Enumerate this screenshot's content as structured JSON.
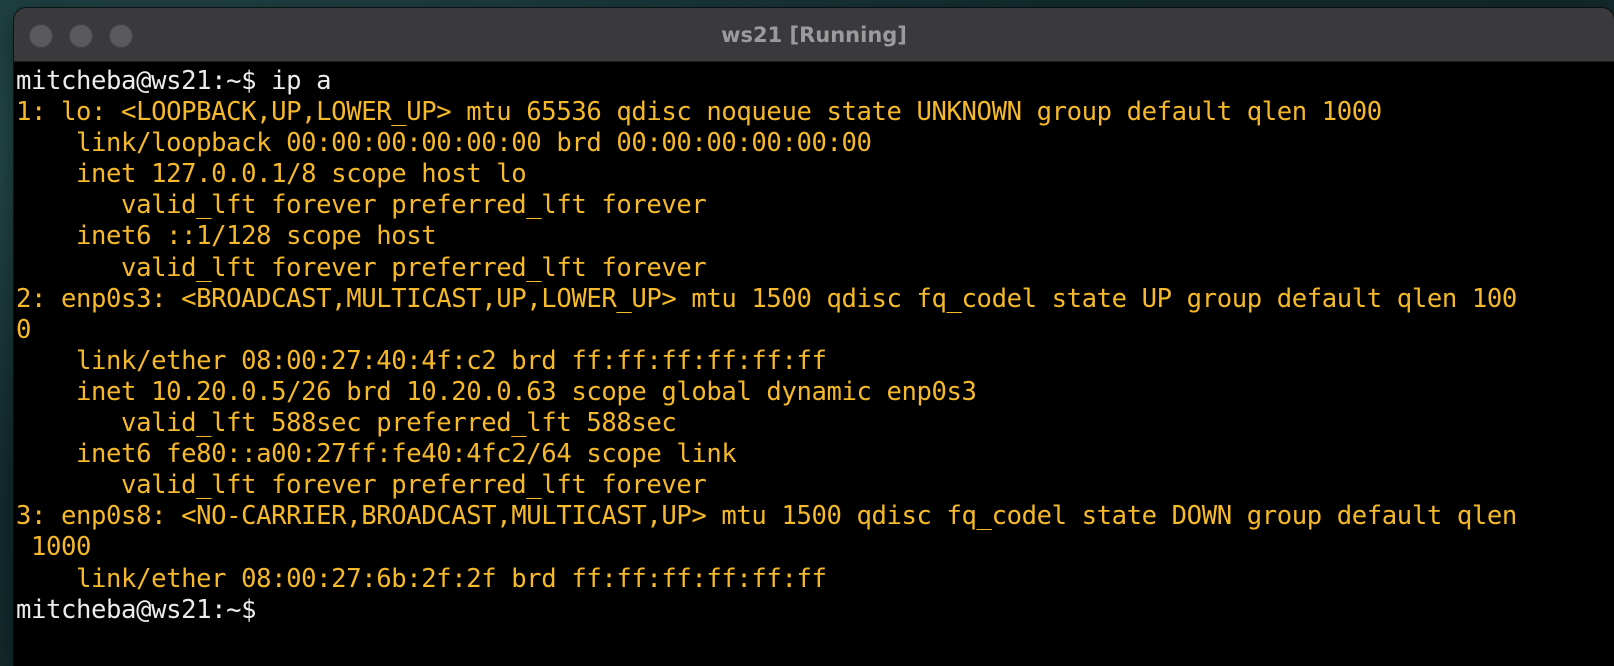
{
  "window": {
    "title": "ws21 [Running]",
    "traffic_lights": [
      "close",
      "minimize",
      "zoom"
    ]
  },
  "colors": {
    "terminal_bg": "#000000",
    "output_text": "#f5b92a",
    "prompt_text": "#ececec",
    "titlebar_bg": "#3a3a3c"
  },
  "terminal": {
    "lines": [
      {
        "text": "mitcheba@ws21:~$ ip a",
        "kind": "prompt"
      },
      {
        "text": "1: lo: <LOOPBACK,UP,LOWER_UP> mtu 65536 qdisc noqueue state UNKNOWN group default qlen 1000",
        "kind": "output"
      },
      {
        "text": "    link/loopback 00:00:00:00:00:00 brd 00:00:00:00:00:00",
        "kind": "output"
      },
      {
        "text": "    inet 127.0.0.1/8 scope host lo",
        "kind": "output"
      },
      {
        "text": "       valid_lft forever preferred_lft forever",
        "kind": "output"
      },
      {
        "text": "    inet6 ::1/128 scope host",
        "kind": "output"
      },
      {
        "text": "       valid_lft forever preferred_lft forever",
        "kind": "output"
      },
      {
        "text": "2: enp0s3: <BROADCAST,MULTICAST,UP,LOWER_UP> mtu 1500 qdisc fq_codel state UP group default qlen 100",
        "kind": "output"
      },
      {
        "text": "0",
        "kind": "output"
      },
      {
        "text": "    link/ether 08:00:27:40:4f:c2 brd ff:ff:ff:ff:ff:ff",
        "kind": "output"
      },
      {
        "text": "    inet 10.20.0.5/26 brd 10.20.0.63 scope global dynamic enp0s3",
        "kind": "output"
      },
      {
        "text": "       valid_lft 588sec preferred_lft 588sec",
        "kind": "output"
      },
      {
        "text": "    inet6 fe80::a00:27ff:fe40:4fc2/64 scope link",
        "kind": "output"
      },
      {
        "text": "       valid_lft forever preferred_lft forever",
        "kind": "output"
      },
      {
        "text": "3: enp0s8: <NO-CARRIER,BROADCAST,MULTICAST,UP> mtu 1500 qdisc fq_codel state DOWN group default qlen",
        "kind": "output"
      },
      {
        "text": " 1000",
        "kind": "output"
      },
      {
        "text": "    link/ether 08:00:27:6b:2f:2f brd ff:ff:ff:ff:ff:ff",
        "kind": "output"
      },
      {
        "text": "mitcheba@ws21:~$",
        "kind": "prompt"
      }
    ]
  }
}
